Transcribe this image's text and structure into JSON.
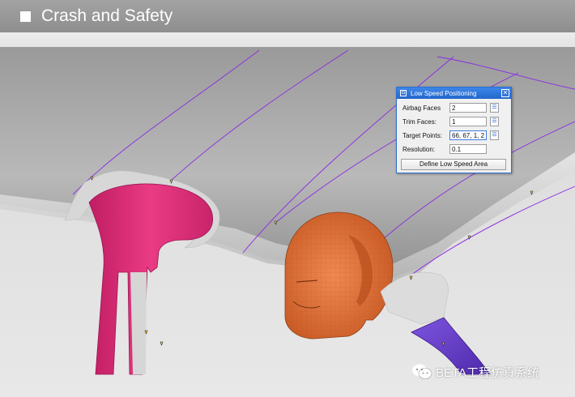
{
  "header": {
    "title": "Crash and Safety"
  },
  "dialog": {
    "title": "Low Speed Positioning",
    "fields": [
      {
        "label": "Airbag Faces",
        "value": "2",
        "has_picker": true
      },
      {
        "label": "Trim Faces:",
        "value": "1",
        "has_picker": true
      },
      {
        "label": "Target Points:",
        "value": "66, 67, 1, 2",
        "has_picker": true
      },
      {
        "label": "Resolution:",
        "value": "0.1",
        "has_picker": false
      }
    ],
    "button_label": "Define Low Speed Area",
    "close_glyph": "✕"
  },
  "watermark": {
    "text": "BETA工程仿真系统"
  },
  "colors": {
    "header_bg": "#999999",
    "dialog_titlebar": "#2a6fd1",
    "pillar_magenta": "#e0307a",
    "headform_orange": "#ea7840",
    "pillar_purple": "#6a3fd0",
    "curve_line": "#8a2be2",
    "marker_yellow": "#f2d21b"
  }
}
